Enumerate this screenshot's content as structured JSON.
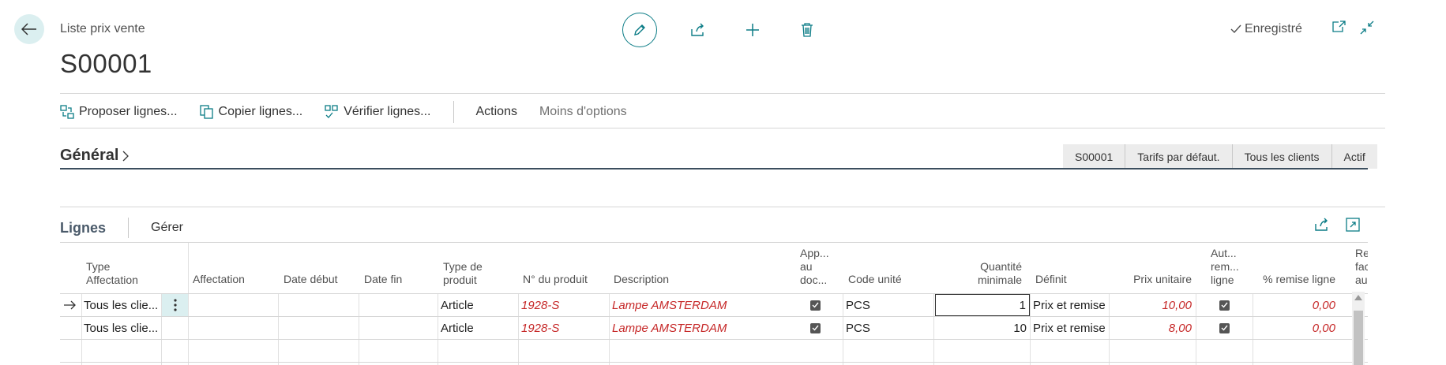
{
  "header": {
    "breadcrumb": "Liste prix vente",
    "title": "S00001",
    "status": "Enregistré"
  },
  "actionbar": {
    "items": [
      {
        "label": "Proposer lignes...",
        "icon": "suggest-lines-icon"
      },
      {
        "label": "Copier lignes...",
        "icon": "copy-lines-icon"
      },
      {
        "label": "Vérifier lignes...",
        "icon": "verify-lines-icon"
      }
    ],
    "actions": "Actions",
    "fewer": "Moins d'options"
  },
  "general": {
    "title": "Général",
    "tags": [
      "S00001",
      "Tarifs par défaut.",
      "Tous les clients",
      "Actif"
    ]
  },
  "lines": {
    "title": "Lignes",
    "manage": "Gérer",
    "columns": [
      {
        "key": "type_aff",
        "label": "Type Affectation"
      },
      {
        "key": "affectation",
        "label": "Affectation"
      },
      {
        "key": "date_debut",
        "label": "Date début"
      },
      {
        "key": "date_fin",
        "label": "Date fin"
      },
      {
        "key": "type_produit",
        "label": "Type de produit"
      },
      {
        "key": "no_produit",
        "label": "N° du produit"
      },
      {
        "key": "description",
        "label": "Description"
      },
      {
        "key": "app_doc",
        "label": "App... au doc..."
      },
      {
        "key": "code_unite",
        "label": "Code unité"
      },
      {
        "key": "qte_min",
        "label": "Quantité minimale"
      },
      {
        "key": "definit",
        "label": "Définit"
      },
      {
        "key": "prix_unitaire",
        "label": "Prix unitaire"
      },
      {
        "key": "aut_remise",
        "label": "Aut... rem... ligne"
      },
      {
        "key": "pct_remise",
        "label": "% remise ligne"
      },
      {
        "key": "re_fac_au",
        "label": "Re fac au"
      }
    ],
    "rows": [
      {
        "type_aff": "Tous les clie...",
        "affectation": "",
        "date_debut": "",
        "date_fin": "",
        "type_produit": "Article",
        "no_produit": "1928-S",
        "description": "Lampe AMSTERDAM",
        "code_unite": "PCS",
        "qte_min": "1",
        "definit": "Prix et remise",
        "prix_unitaire": "10,00",
        "pct_remise": "0,00"
      },
      {
        "type_aff": "Tous les clie...",
        "affectation": "",
        "date_debut": "",
        "date_fin": "",
        "type_produit": "Article",
        "no_produit": "1928-S",
        "description": "Lampe AMSTERDAM",
        "code_unite": "PCS",
        "qte_min": "10",
        "definit": "Prix et remise",
        "prix_unitaire": "8,00",
        "pct_remise": "0,00"
      }
    ]
  },
  "colors": {
    "accent": "#0b7c86",
    "red_value": "#c62828"
  }
}
